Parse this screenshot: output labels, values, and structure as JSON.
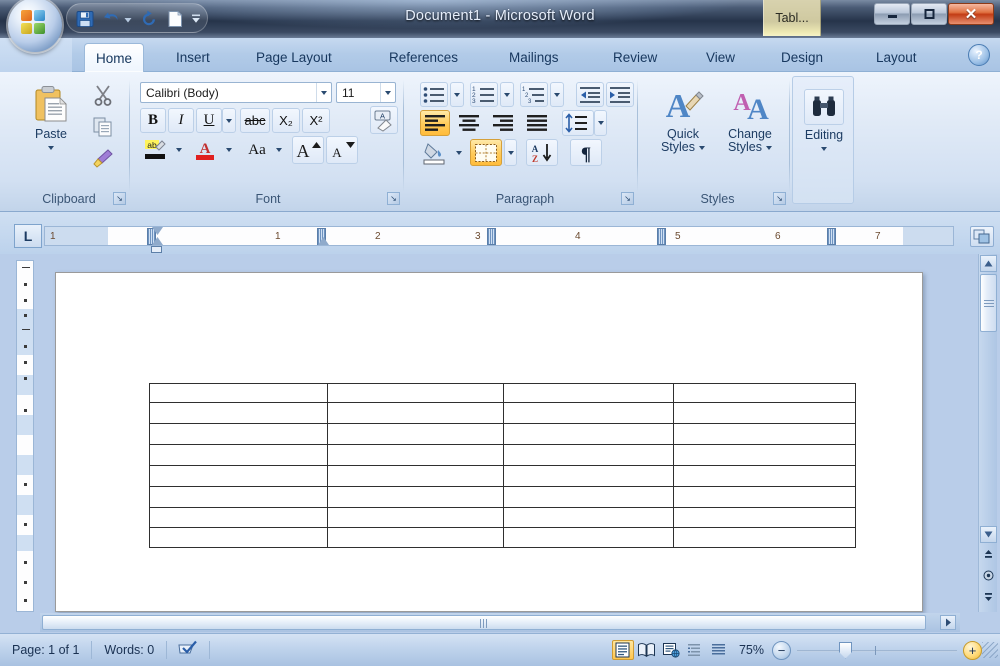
{
  "window": {
    "title": "Document1 - Microsoft Word",
    "contextual_tab": "Tabl...",
    "minimize": "–",
    "maximize": "□",
    "close": "✕",
    "office_button": "office-logo"
  },
  "quick_access": [
    {
      "name": "save",
      "icon": "floppy-disk-icon",
      "tooltip": "Save"
    },
    {
      "name": "undo",
      "icon": "undo-arrow-icon",
      "tooltip": "Undo"
    },
    {
      "name": "undo-dropdown",
      "icon": "chevron-down-icon",
      "tooltip": "Undo history"
    },
    {
      "name": "redo",
      "icon": "redo-arrow-icon",
      "tooltip": "Redo"
    },
    {
      "name": "new",
      "icon": "new-document-icon",
      "tooltip": "New"
    },
    {
      "name": "customize",
      "icon": "chevron-down-icon",
      "tooltip": "Customize Quick Access Toolbar"
    }
  ],
  "tabs": [
    {
      "label": "Home",
      "active": true
    },
    {
      "label": "Insert",
      "active": false
    },
    {
      "label": "Page Layout",
      "active": false
    },
    {
      "label": "References",
      "active": false
    },
    {
      "label": "Mailings",
      "active": false
    },
    {
      "label": "Review",
      "active": false
    },
    {
      "label": "View",
      "active": false
    },
    {
      "label": "Design",
      "active": false
    },
    {
      "label": "Layout",
      "active": false
    }
  ],
  "help": {
    "label": "?",
    "icon": "help-question-icon"
  },
  "ribbon": {
    "clipboard": {
      "name": "Clipboard",
      "paste_label": "Paste",
      "paste_icon": "clipboard-paste-icon",
      "cut_icon": "scissors-icon",
      "copy_icon": "copy-pages-icon",
      "format_painter_icon": "paintbrush-icon",
      "dialog_launcher": "↘"
    },
    "font": {
      "name": "Font",
      "font_name": "Calibri (Body)",
      "font_size": "11",
      "bold": "B",
      "italic": "I",
      "underline": "U",
      "strikethrough": "abc",
      "subscript": "X₂",
      "superscript": "X²",
      "clear_formatting_icon": "clear-formatting-icon",
      "highlight_icon": "text-highlight-icon",
      "font_color_icon": "font-color-icon",
      "change_case": "Aa",
      "grow_font": "A",
      "shrink_font": "A",
      "dialog_launcher": "↘"
    },
    "paragraph": {
      "name": "Paragraph",
      "bullets_icon": "bulleted-list-icon",
      "numbering_icon": "numbered-list-icon",
      "multilevel_icon": "multilevel-list-icon",
      "decrease_indent_icon": "decrease-indent-icon",
      "increase_indent_icon": "increase-indent-icon",
      "align_left_icon": "align-left-icon",
      "align_center_icon": "align-center-icon",
      "align_right_icon": "align-right-icon",
      "justify_icon": "justify-icon",
      "line_spacing_icon": "line-spacing-icon",
      "shading_icon": "shading-paint-bucket-icon",
      "borders_icon": "borders-grid-icon",
      "sort_icon": "sort-az-icon",
      "show_marks_icon": "pilcrow-icon",
      "dialog_launcher": "↘",
      "align_left_active": true,
      "borders_active": true
    },
    "styles": {
      "name": "Styles",
      "quick_styles_line1": "Quick",
      "quick_styles_line2": "Styles",
      "quick_styles_icon": "a-with-brush-icon",
      "change_styles_line1": "Change",
      "change_styles_line2": "Styles",
      "change_styles_icon": "double-a-icon",
      "dialog_launcher": "↘"
    },
    "editing": {
      "name": "Editing",
      "label": "Editing",
      "icon": "binoculars-find-icon"
    }
  },
  "ruler": {
    "tab_selector": "L",
    "tab_selector_icon": "left-tab-stop-icon",
    "marks": [
      "1",
      "1",
      "2",
      "3",
      "4",
      "5",
      "6",
      "7"
    ],
    "object_browse_icon": "select-object-icon"
  },
  "document": {
    "table": {
      "rows": 8,
      "columns": 4,
      "cells": []
    }
  },
  "scrollbars": {
    "up_icon": "triangle-up-icon",
    "down_icon": "triangle-down-icon",
    "right_icon": "triangle-right-icon",
    "prev_page_icon": "previous-page-icon",
    "browse_object_icon": "select-browse-object-icon",
    "next_page_icon": "next-page-icon"
  },
  "status_bar": {
    "page": "Page: 1 of 1",
    "words": "Words: 0",
    "proofing_icon": "spell-check-icon",
    "views": [
      {
        "name": "print-layout",
        "icon": "print-layout-icon",
        "selected": true
      },
      {
        "name": "full-screen-reading",
        "icon": "book-open-icon",
        "selected": false
      },
      {
        "name": "web-layout",
        "icon": "web-layout-icon",
        "selected": false
      },
      {
        "name": "outline",
        "icon": "outline-icon",
        "selected": false
      },
      {
        "name": "draft",
        "icon": "draft-icon",
        "selected": false
      }
    ],
    "zoom": "75%",
    "zoom_out": "−",
    "zoom_in": "+",
    "resize_grip": "resize-grip-icon"
  },
  "colors": {
    "ribbon_blue": "#c6d9f0",
    "title_dark": "#26344a",
    "accent_orange": "#ffc64f",
    "text_blue": "#17375e",
    "page_white": "#ffffff"
  }
}
